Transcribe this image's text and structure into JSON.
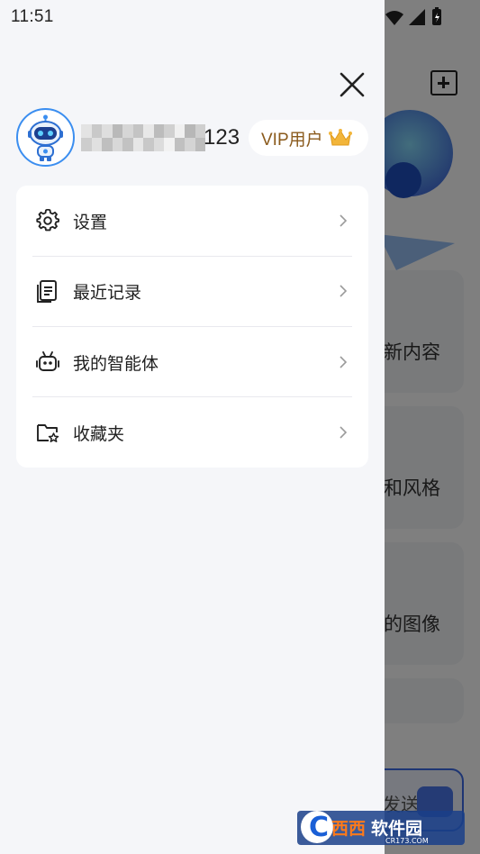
{
  "status_bar": {
    "time": "11:51"
  },
  "background": {
    "cards": [
      "新内容",
      "和风格",
      "的图像"
    ],
    "send_label": "发送"
  },
  "drawer": {
    "close_icon": "close-icon",
    "user": {
      "name_suffix": "123",
      "vip_label": "VIP用户"
    },
    "menu": [
      {
        "label": "设置",
        "icon": "gear-icon"
      },
      {
        "label": "最近记录",
        "icon": "document-icon"
      },
      {
        "label": "我的智能体",
        "icon": "robot-icon"
      },
      {
        "label": "收藏夹",
        "icon": "folder-star-icon"
      }
    ]
  },
  "watermark": {
    "text": "西西软件园",
    "sub": "CR173.COM"
  },
  "colors": {
    "accent": "#3b8ef0",
    "vip": "#8a5a1c",
    "crown": "#f2b53a"
  }
}
